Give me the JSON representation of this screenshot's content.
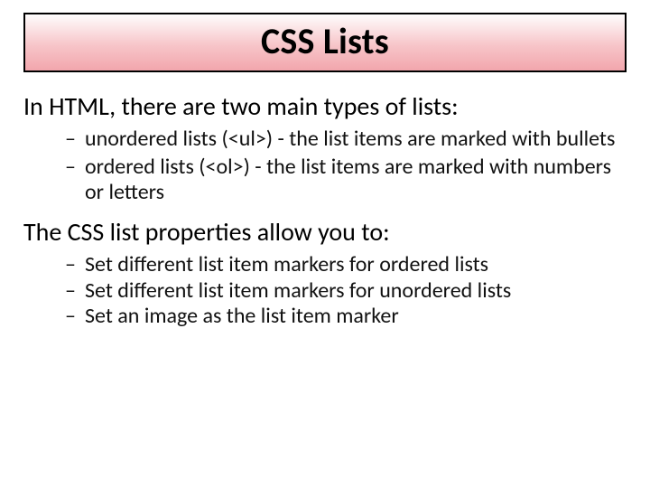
{
  "title": "CSS Lists",
  "section1": {
    "lead": "In HTML, there are two main types of lists:",
    "items": [
      "unordered lists (<ul>) - the list items are marked with bullets",
      "ordered lists (<ol>) - the list items are marked with numbers or letters"
    ]
  },
  "section2": {
    "lead": "The CSS list properties allow you to:",
    "items": [
      "Set different list item markers for ordered lists",
      "Set different list item markers for unordered lists",
      "Set an image as the list item marker"
    ]
  }
}
